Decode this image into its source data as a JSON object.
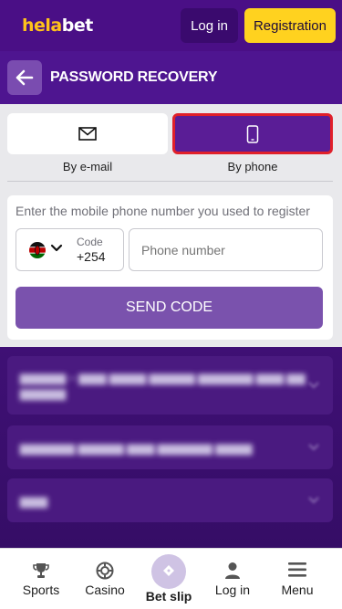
{
  "header": {
    "logo_part1": "hela",
    "logo_part2": "bet",
    "login_label": "Log in",
    "register_label": "Registration"
  },
  "titlebar": {
    "back_icon": "arrow-left-icon",
    "title": "PASSWORD RECOVERY"
  },
  "recovery": {
    "tabs": [
      {
        "label": "By e-mail",
        "icon": "envelope-icon",
        "selected": false
      },
      {
        "label": "By phone",
        "icon": "smartphone-icon",
        "selected": true
      }
    ],
    "hint": "Enter the mobile phone number you used to register",
    "country_flag": "kenya-flag-icon",
    "code_label": "Code",
    "code_value": "+254",
    "phone_placeholder": "Phone number",
    "send_label": "SEND CODE"
  },
  "bottom_nav": {
    "items": [
      {
        "label": "Sports",
        "icon": "trophy-icon"
      },
      {
        "label": "Casino",
        "icon": "casino-chip-icon"
      },
      {
        "label": "Bet slip",
        "icon": "ticket-icon"
      },
      {
        "label": "Log in",
        "icon": "user-icon"
      },
      {
        "label": "Menu",
        "icon": "hamburger-menu-icon"
      }
    ]
  },
  "colors": {
    "brand_purple": "#4a0f86",
    "accent_yellow": "#ffd21f",
    "selected_border": "#e0202a",
    "send_button": "#7a52ad"
  }
}
